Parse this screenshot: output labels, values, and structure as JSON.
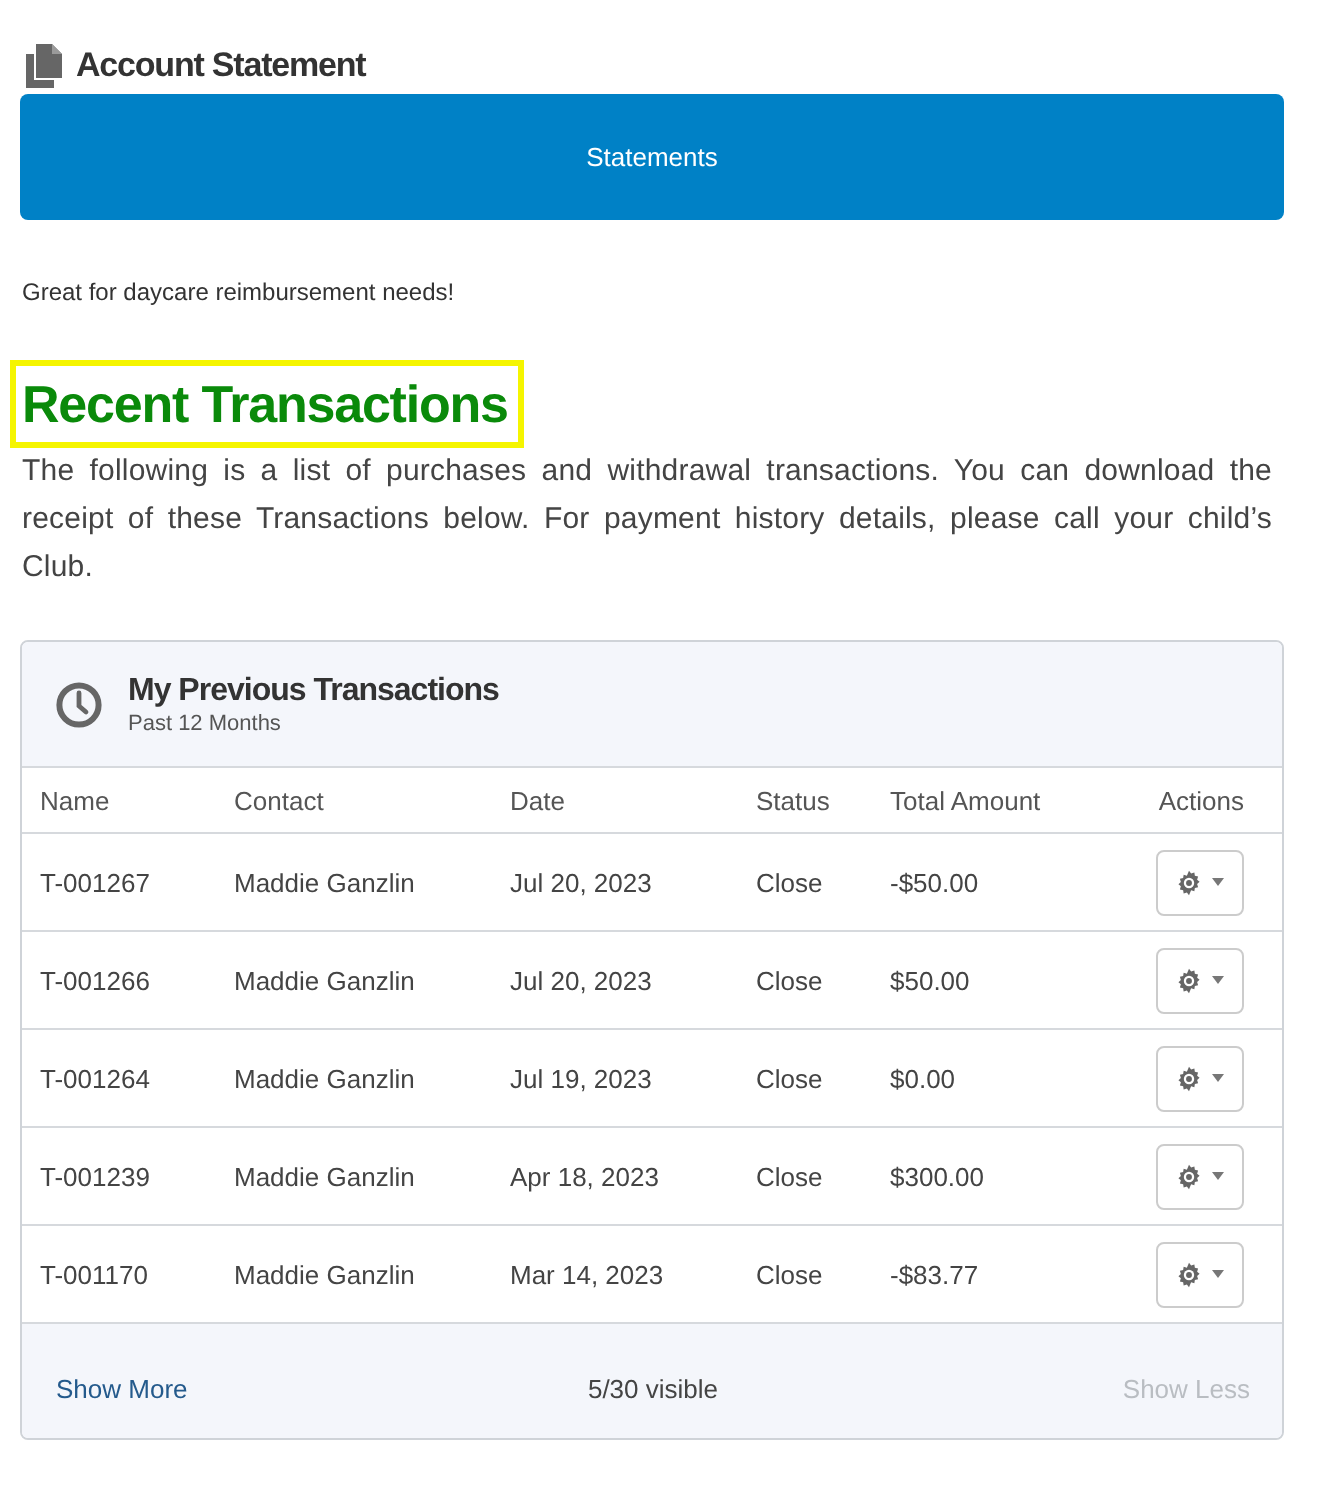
{
  "header": {
    "title": "Account Statement"
  },
  "statements_button": {
    "label": "Statements"
  },
  "note": "Great for daycare reimbursement needs!",
  "section": {
    "title": "Recent Transactions",
    "highlighted": true,
    "description": "The following is a list of purchases and withdrawal transactions. You can download the receipt of these Transactions below. For payment history details, please call your child’s Club."
  },
  "card": {
    "title": "My Previous Transactions",
    "subtitle": "Past 12 Months",
    "columns": [
      "Name",
      "Contact",
      "Date",
      "Status",
      "Total Amount",
      "Actions"
    ],
    "rows": [
      {
        "name": "T-001267",
        "contact": "Maddie Ganzlin",
        "date": "Jul 20, 2023",
        "status": "Close",
        "total_amount": "-$50.00"
      },
      {
        "name": "T-001266",
        "contact": "Maddie Ganzlin",
        "date": "Jul 20, 2023",
        "status": "Close",
        "total_amount": "$50.00"
      },
      {
        "name": "T-001264",
        "contact": "Maddie Ganzlin",
        "date": "Jul 19, 2023",
        "status": "Close",
        "total_amount": "$0.00"
      },
      {
        "name": "T-001239",
        "contact": "Maddie Ganzlin",
        "date": "Apr 18, 2023",
        "status": "Close",
        "total_amount": "$300.00"
      },
      {
        "name": "T-001170",
        "contact": "Maddie Ganzlin",
        "date": "Mar 14, 2023",
        "status": "Close",
        "total_amount": "-$83.77"
      }
    ],
    "footer": {
      "show_more": {
        "label": "Show More",
        "disabled": false
      },
      "count": "5/30 visible",
      "show_less": {
        "label": "Show Less",
        "disabled": true
      }
    }
  }
}
